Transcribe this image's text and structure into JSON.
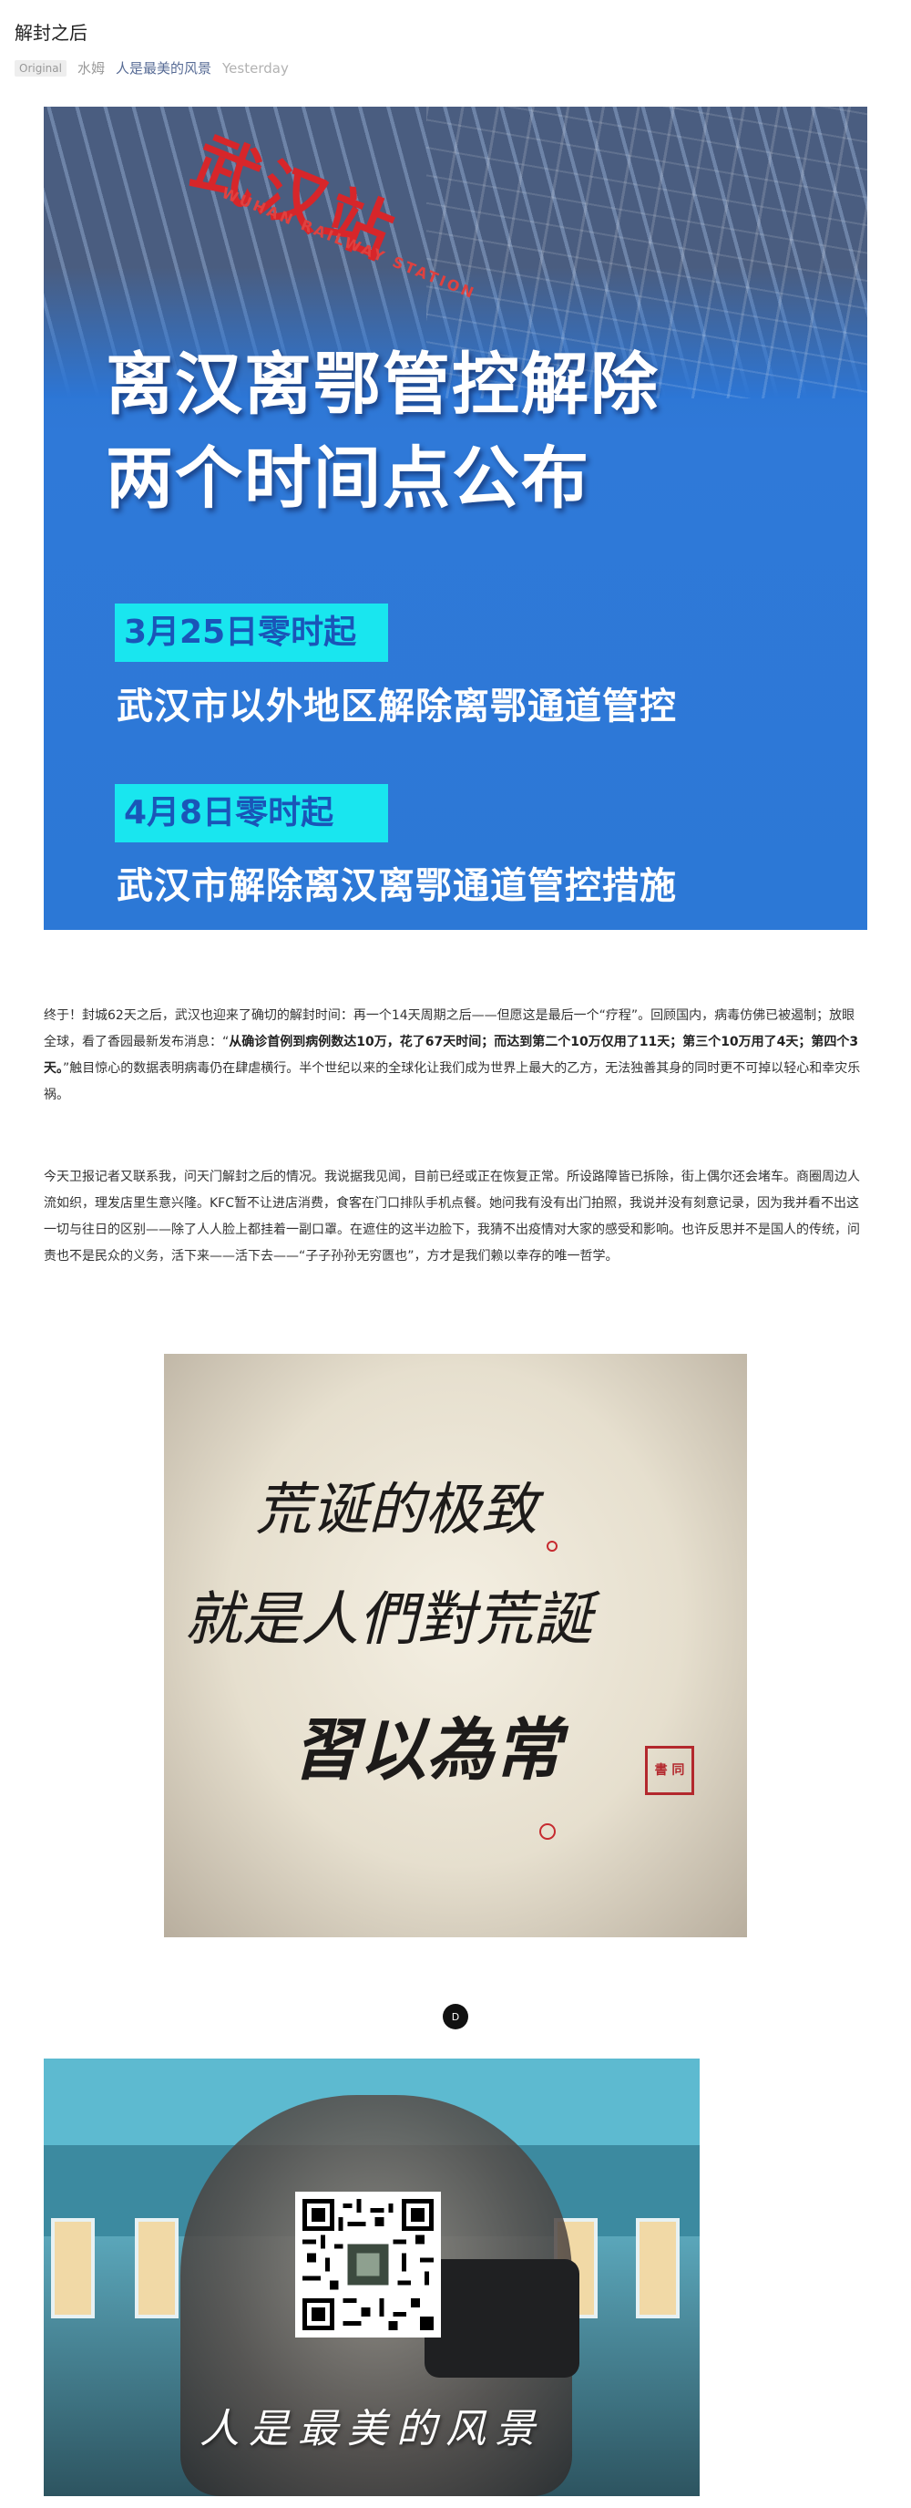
{
  "article": {
    "title": "解封之后",
    "original_tag": "Original",
    "author": "水姆",
    "account": "人是最美的风景",
    "date": "Yesterday"
  },
  "poster": {
    "station_sign": "武汉站",
    "station_sign_en": "WUHAN RAILWAY STATION",
    "headline_1": "离汉离鄂管控解除",
    "headline_2": "两个时间点公布",
    "date_1": "3月25日零时起",
    "notice_1": "武汉市以外地区解除离鄂通道管控",
    "date_2": "4月8日零时起",
    "notice_2": "武汉市解除离汉离鄂通道管控措施"
  },
  "paragraph_1": {
    "part_1": "终于！封城62天之后，武汉也迎来了确切的解封时间：再一个14天周期之后——但愿这是最后一个“疗程”。回顾国内，病毒仿佛已被遏制；放眼全球，看了香园最新发布消息：“",
    "bold_1": "从确诊首例到病例数达10万，花了67天时间；而达到第二个10万仅用了11天；第三个10万用了4天；第四个3天。",
    "part_2": "”触目惊心的数据表明病毒仍在肆虐横行。半个世纪以来的全球化让我们成为世界上最大的乙方，无法独善其身的同时更不可掉以轻心和幸灾乐祸。"
  },
  "paragraph_2": "今天卫报记者又联系我，问天门解封之后的情况。我说据我见闻，目前已经或正在恢复正常。所设路障皆已拆除，街上偶尔还会堵车。商圈周边人流如织，理发店里生意兴隆。KFC暂不让进店消费，食客在门口排队手机点餐。她问我有没有出门拍照，我说并没有刻意记录，因为我并看不出这一切与往日的区别——除了人人脸上都挂着一副口罩。在遮住的这半边脸下，我猜不出疫情对大家的感受和影响。也许反思并不是国人的传统，问责也不是民众的义务，活下来——活下去——“子子孙孙无穷匮也”，方才是我们赖以幸存的唯一哲学。",
  "calligraphy": {
    "line_1": "荒诞的极致",
    "line_2": "就是人們對荒誕",
    "line_3": "習以為常",
    "seal": "書 同"
  },
  "divider_glyph": "D",
  "banner": {
    "caption": "人是最美的风景"
  },
  "icons": {
    "qr_code": "qr-code-icon"
  }
}
